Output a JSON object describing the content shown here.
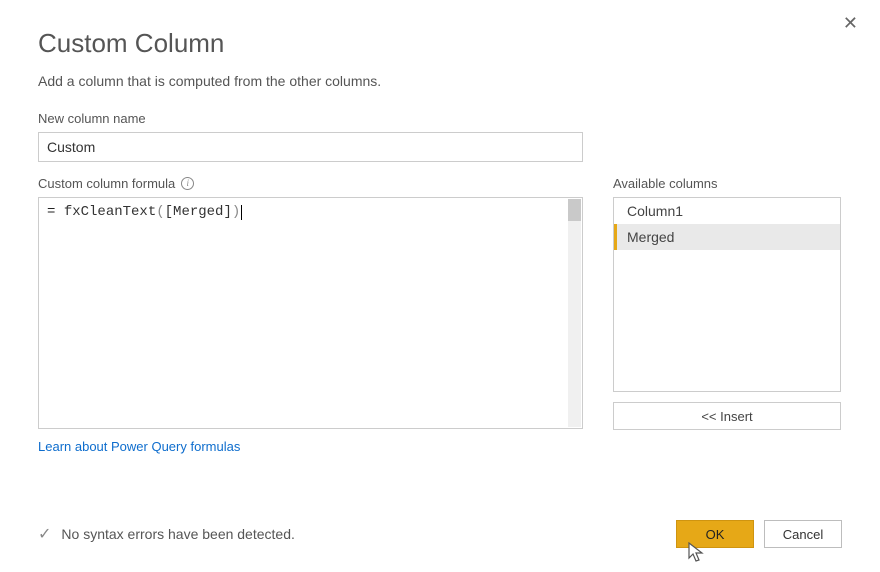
{
  "dialog": {
    "title": "Custom Column",
    "subtitle": "Add a column that is computed from the other columns.",
    "close_glyph": "✕"
  },
  "newColumn": {
    "label": "New column name",
    "value": "Custom"
  },
  "formula": {
    "label": "Custom column formula",
    "prefix": "= ",
    "fn": "fxCleanText",
    "open": "(",
    "arg": "[Merged]",
    "close": ")"
  },
  "available": {
    "label": "Available columns",
    "items": [
      "Column1",
      "Merged"
    ],
    "selected_index": 1,
    "insert_label": "<< Insert"
  },
  "learn_link": "Learn about Power Query formulas",
  "status": {
    "check": "✓",
    "text": "No syntax errors have been detected."
  },
  "buttons": {
    "ok": "OK",
    "cancel": "Cancel"
  },
  "info_glyph": "i"
}
